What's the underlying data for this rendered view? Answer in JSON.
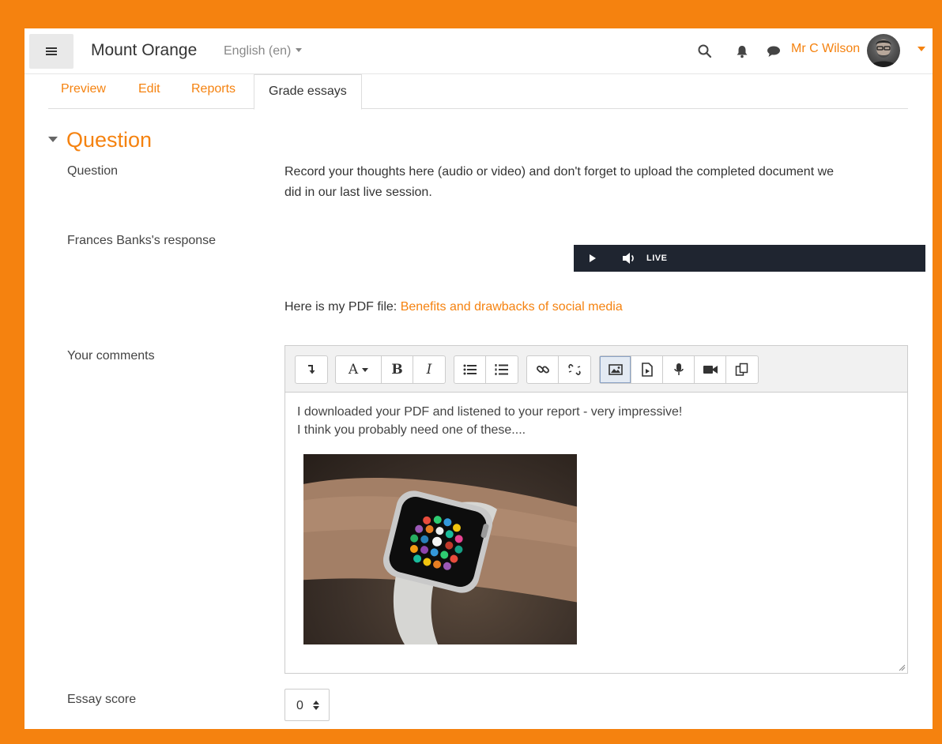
{
  "header": {
    "site_name": "Mount Orange",
    "language": "English (en)",
    "user_name": "Mr C Wilson",
    "icons": [
      "menu-icon",
      "search-icon",
      "bell-icon",
      "chat-icon",
      "avatar",
      "caret-down-icon"
    ]
  },
  "tabs": [
    {
      "label": "Preview"
    },
    {
      "label": "Edit"
    },
    {
      "label": "Reports"
    },
    {
      "label": "Grade essays",
      "active": true
    }
  ],
  "section": {
    "title": "Question"
  },
  "question": {
    "label": "Question",
    "text_line1": "Record your thoughts here (audio or video) and don't forget to upload the completed document we",
    "text_line2": "did in our last live session."
  },
  "response": {
    "label": "Frances Banks's response",
    "player_live": "LIVE",
    "pdf_prefix": "Here is my PDF file: ",
    "pdf_link": "Benefits and drawbacks of social media"
  },
  "comments": {
    "label": "Your comments",
    "line1": "I downloaded your PDF and listened to your report - very impressive!",
    "line2": "I think you probably  need one of these....",
    "toolbar": {
      "font_label": "A",
      "bold": "B",
      "italic": "I"
    }
  },
  "score": {
    "label": "Essay score",
    "value": "0"
  },
  "colors": {
    "accent": "#f5820f",
    "player_bg": "#1f2530"
  }
}
